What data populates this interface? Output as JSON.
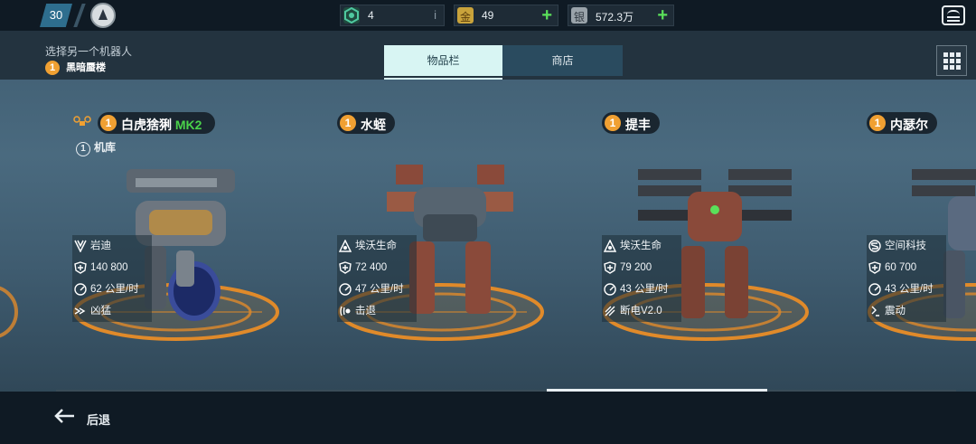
{
  "topbar": {
    "level": "30",
    "currencies": [
      {
        "name": "gems",
        "value": "4",
        "color": "#4fc9a0",
        "icon": "hex-gem-icon",
        "info": "i"
      },
      {
        "name": "gold",
        "label": "金",
        "value": "49",
        "color": "#c9a33b",
        "icon": "gold-icon"
      },
      {
        "name": "silver",
        "label": "银",
        "value": "572.3万",
        "color": "#9aa3aa",
        "icon": "silver-icon"
      }
    ]
  },
  "header": {
    "subtitle": "选择另一个机器人",
    "selected_count": "1",
    "selected_robot": "黑暗蜃楼",
    "tabs": [
      {
        "label": "物品栏",
        "active": true
      },
      {
        "label": "商店",
        "active": false
      }
    ]
  },
  "robots": [
    {
      "count": "1",
      "name": "白虎猞猁",
      "mk": "MK2",
      "garage_num": "1",
      "garage_label": "机库",
      "faction": "岩迪",
      "hp": "140 800",
      "speed": "62 公里/时",
      "ability": "凶猛"
    },
    {
      "count": "1",
      "name": "水蛭",
      "faction": "埃沃生命",
      "hp": "72 400",
      "speed": "47 公里/时",
      "ability": "击退"
    },
    {
      "count": "1",
      "name": "提丰",
      "faction": "埃沃生命",
      "hp": "79 200",
      "speed": "43 公里/时",
      "ability": "断电V2.0"
    },
    {
      "count": "1",
      "name": "内瑟尔",
      "faction": "空间科技",
      "hp": "60 700",
      "speed": "43 公里/时",
      "ability": "震动"
    }
  ],
  "bottom": {
    "back_label": "后退"
  },
  "colors": {
    "accent": "#f0a032",
    "mk": "#4ad24a",
    "tab_active": "#d8f5f3",
    "platform": "#e08a2a"
  }
}
